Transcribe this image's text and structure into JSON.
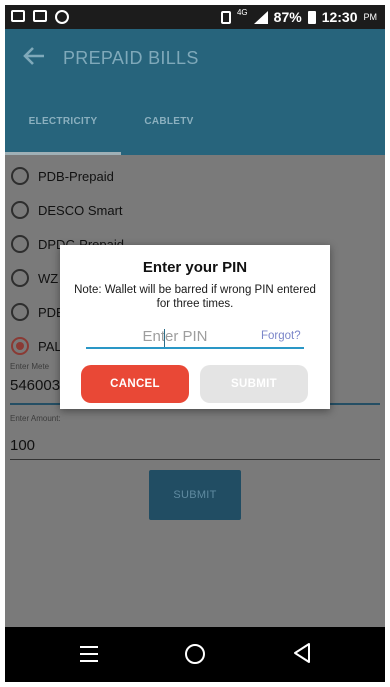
{
  "statusbar": {
    "network": "4G",
    "battery": "87%",
    "time": "12:30",
    "ampm": "PM",
    "icons": [
      "mail-icon",
      "image-icon",
      "messenger-icon",
      "vibrate-icon",
      "signal-icon",
      "battery-icon"
    ]
  },
  "appbar": {
    "back_icon": "arrow-left-icon",
    "title": "PREPAID BILLS"
  },
  "tabs": [
    {
      "label": "ELECTRICITY",
      "selected": true
    },
    {
      "label": "CABLETV",
      "selected": false
    }
  ],
  "providers": [
    {
      "label": "PDB-Prepaid",
      "selected": false
    },
    {
      "label": "DESCO Smart",
      "selected": false
    },
    {
      "label": "DPDC-Prepaid",
      "selected": false
    },
    {
      "label": "WZ",
      "selected": false
    },
    {
      "label": "PDE",
      "selected": false
    },
    {
      "label": "PAL",
      "selected": true
    }
  ],
  "meter_field": {
    "label": "Enter Mete",
    "value": "546003"
  },
  "amount_field": {
    "label": "Enter Amount:",
    "value": "100"
  },
  "submit_label": "SUBMIT",
  "dialog": {
    "title": "Enter your PIN",
    "note": "Note: Wallet will be barred if wrong PIN entered for three times.",
    "pin_placeholder": "Enter PIN",
    "pin_value": "",
    "forgot_label": "Forgot?",
    "cancel_label": "CANCEL",
    "submit_label": "SUBMIT"
  },
  "navbar": {
    "icons": [
      "menu-icon",
      "home-icon",
      "back-triangle-icon"
    ]
  },
  "colors": {
    "appbar": "#27647c",
    "cancel": "#e94836",
    "submit_disabled": "#e4e4e4",
    "input_underline": "#2a97c6",
    "forgot_link": "#7b86c9"
  }
}
